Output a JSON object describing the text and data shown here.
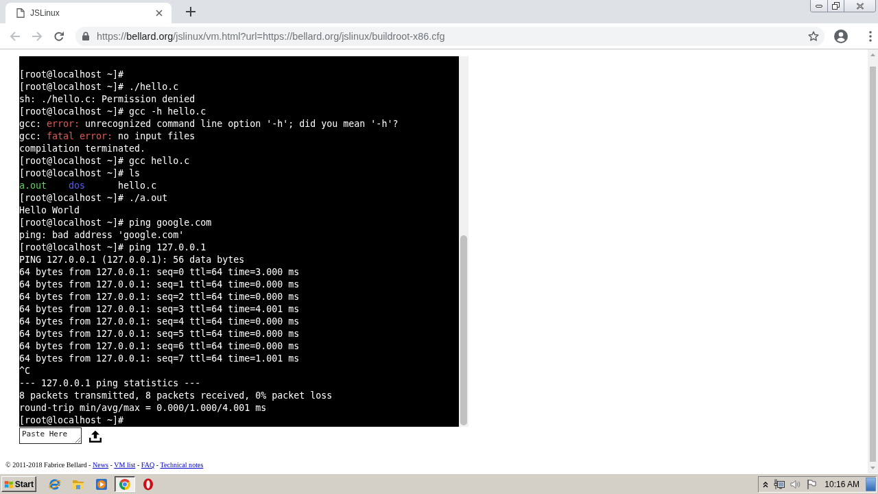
{
  "browser": {
    "tabs": [
      {
        "title": "JSLinux",
        "selected": true
      }
    ],
    "nav": [
      {
        "kind": "back",
        "disabled": true
      },
      {
        "kind": "forward",
        "disabled": true
      },
      {
        "kind": "reload",
        "disabled": false
      }
    ],
    "address": {
      "parts": [
        {
          "text": "https://",
          "kind": "dim"
        },
        {
          "text": "bellard.org",
          "kind": "host"
        },
        {
          "text": "/jslinux/vm.html?url=https://bellard.org/jslinux/buildroot-x86.cfg",
          "kind": "dim"
        }
      ]
    }
  },
  "terminal": {
    "lines": [
      {
        "kind": "plain",
        "text": "[root@localhost ~]#"
      },
      {
        "kind": "plain",
        "text": "[root@localhost ~]# ./hello.c"
      },
      {
        "kind": "plain",
        "text": "sh: ./hello.c: Permission denied"
      },
      {
        "kind": "plain",
        "text": "[root@localhost ~]# gcc -h hello.c"
      },
      {
        "kind": "colored",
        "spans": [
          {
            "text": "gcc: "
          },
          {
            "text": "error:",
            "color": "#e35b55"
          },
          {
            "text": " unrecognized command line option '-h'; did you mean '-h'?"
          }
        ]
      },
      {
        "kind": "colored",
        "spans": [
          {
            "text": "gcc: "
          },
          {
            "text": "fatal error:",
            "color": "#e35b55"
          },
          {
            "text": " no input files"
          }
        ]
      },
      {
        "kind": "plain",
        "text": "compilation terminated."
      },
      {
        "kind": "plain",
        "text": "[root@localhost ~]# gcc hello.c"
      },
      {
        "kind": "plain",
        "text": "[root@localhost ~]# ls"
      },
      {
        "kind": "listing",
        "entries": [
          {
            "text": "a.out",
            "color": "#5fd35f"
          },
          {
            "text": "dos",
            "color": "#5c5cee"
          },
          {
            "text": "hello.c",
            "color": "#ffffff"
          }
        ]
      },
      {
        "kind": "plain",
        "text": "[root@localhost ~]# ./a.out"
      },
      {
        "kind": "plain",
        "text": "Hello World"
      },
      {
        "kind": "plain",
        "text": "[root@localhost ~]# ping google.com"
      },
      {
        "kind": "plain",
        "text": "ping: bad address 'google.com'"
      },
      {
        "kind": "plain",
        "text": "[root@localhost ~]# ping 127.0.0.1"
      },
      {
        "kind": "plain",
        "text": "PING 127.0.0.1 (127.0.0.1): 56 data bytes"
      },
      {
        "kind": "plain",
        "text": "64 bytes from 127.0.0.1: seq=0 ttl=64 time=3.000 ms"
      },
      {
        "kind": "plain",
        "text": "64 bytes from 127.0.0.1: seq=1 ttl=64 time=0.000 ms"
      },
      {
        "kind": "plain",
        "text": "64 bytes from 127.0.0.1: seq=2 ttl=64 time=0.000 ms"
      },
      {
        "kind": "plain",
        "text": "64 bytes from 127.0.0.1: seq=3 ttl=64 time=4.001 ms"
      },
      {
        "kind": "plain",
        "text": "64 bytes from 127.0.0.1: seq=4 ttl=64 time=0.000 ms"
      },
      {
        "kind": "plain",
        "text": "64 bytes from 127.0.0.1: seq=5 ttl=64 time=0.000 ms"
      },
      {
        "kind": "plain",
        "text": "64 bytes from 127.0.0.1: seq=6 ttl=64 time=0.000 ms"
      },
      {
        "kind": "plain",
        "text": "64 bytes from 127.0.0.1: seq=7 ttl=64 time=1.001 ms"
      },
      {
        "kind": "plain",
        "text": "^C"
      },
      {
        "kind": "plain",
        "text": "--- 127.0.0.1 ping statistics ---"
      },
      {
        "kind": "plain",
        "text": "8 packets transmitted, 8 packets received, 0% packet loss"
      },
      {
        "kind": "plain",
        "text": "round-trip min/avg/max = 0.000/1.000/4.001 ms"
      },
      {
        "kind": "plain",
        "text": "[root@localhost ~]#"
      }
    ]
  },
  "paste_field": {
    "placeholder": "Paste Here"
  },
  "footer": {
    "parts": [
      {
        "text": "© 2011-2018 Fabrice Bellard - ",
        "kind": "text"
      },
      {
        "text": "News",
        "kind": "link"
      },
      {
        "text": " - ",
        "kind": "text"
      },
      {
        "text": "VM list",
        "kind": "link"
      },
      {
        "text": " - ",
        "kind": "text"
      },
      {
        "text": "FAQ",
        "kind": "link"
      },
      {
        "text": " - ",
        "kind": "text"
      },
      {
        "text": "Technical notes",
        "kind": "link"
      }
    ]
  },
  "taskbar": {
    "start_label": "Start",
    "items": [
      {
        "kind": "ie",
        "selected": false
      },
      {
        "kind": "folder",
        "selected": false
      },
      {
        "kind": "media",
        "selected": false
      },
      {
        "kind": "chrome",
        "selected": true
      },
      {
        "kind": "opera",
        "selected": false
      }
    ],
    "clock": "10:16 AM"
  }
}
